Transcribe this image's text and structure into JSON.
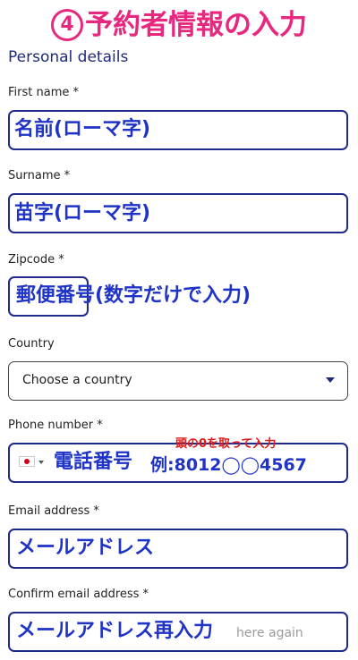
{
  "header": {
    "step_number": "4",
    "step_title": "予約者情報の入力"
  },
  "section_heading": "Personal details",
  "fields": {
    "first_name": {
      "label": "First name *",
      "annotation": "名前(ローマ字)"
    },
    "surname": {
      "label": "Surname *",
      "annotation": "苗字(ローマ字)"
    },
    "zipcode": {
      "label": "Zipcode *",
      "annotation": "郵便番号(数字だけで入力)"
    },
    "country": {
      "label": "Country",
      "selected": "Choose a country"
    },
    "phone": {
      "label": "Phone number *",
      "annotation": "電話番号",
      "example_label": "例:8012◯◯4567",
      "note": "頭の0を取って入力"
    },
    "email": {
      "label": "Email address *",
      "annotation": "メールアドレス"
    },
    "confirm_email": {
      "label": "Confirm email address *",
      "annotation": "メールアドレス再入力",
      "placeholder_visible": "here again"
    }
  },
  "colors": {
    "title": "#e8287e",
    "annotation": "#1f33c7",
    "field_border": "#1f2a8a",
    "note": "#e01a1a"
  },
  "icons": {
    "country_dropdown": "chevron-down-icon",
    "phone_flag": "japan-flag-icon"
  }
}
